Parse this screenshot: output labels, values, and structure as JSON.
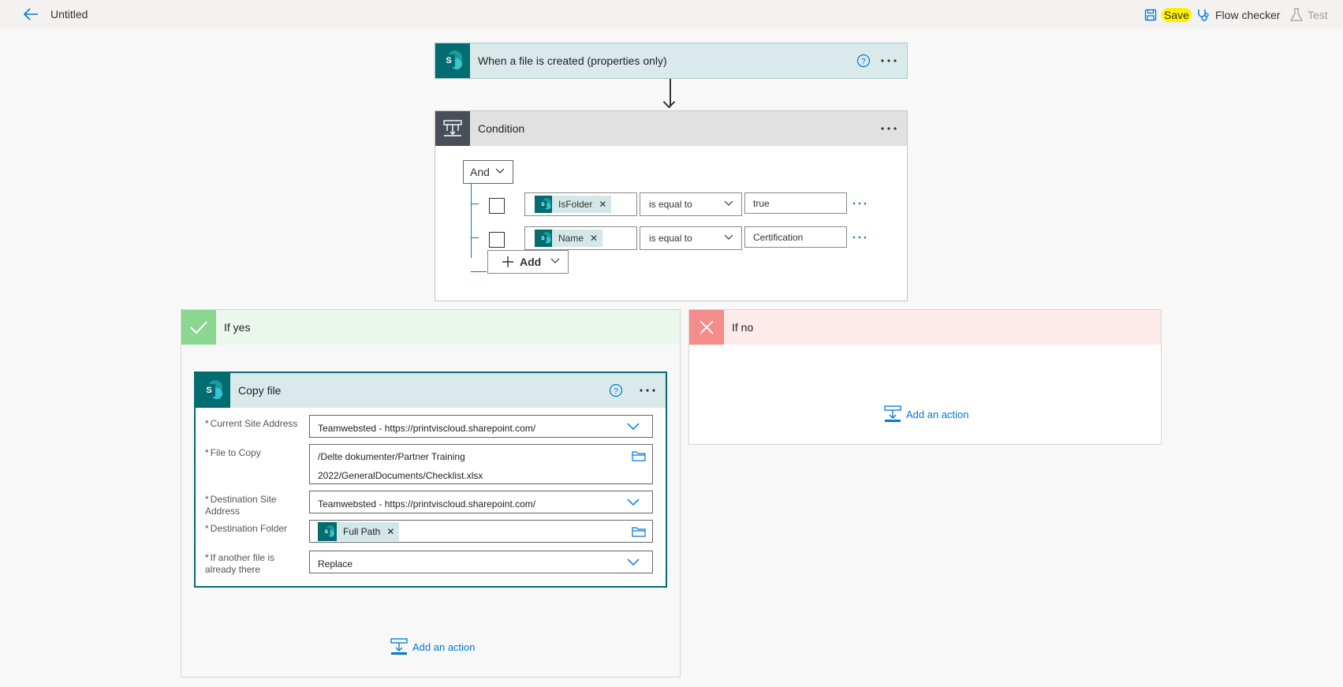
{
  "topbar": {
    "title": "Untitled",
    "save_label": "Save",
    "checker_label": "Flow checker",
    "test_label": "Test"
  },
  "trigger": {
    "title": "When a file is created (properties only)"
  },
  "condition": {
    "title": "Condition",
    "group_operator": "And",
    "rows": [
      {
        "field": "IsFolder",
        "operator": "is equal to",
        "value": "true"
      },
      {
        "field": "Name",
        "operator": "is equal to",
        "value": "Certification"
      }
    ],
    "add_label": "Add"
  },
  "branches": {
    "yes_title": "If yes",
    "no_title": "If no",
    "add_action_label": "Add an action"
  },
  "copy_file": {
    "title": "Copy file",
    "fields": {
      "current_site_label": "Current Site Address",
      "current_site_value": "Teamwebsted - https://printviscloud.sharepoint.com/",
      "file_to_copy_label": "File to Copy",
      "file_to_copy_line1": "/Delte dokumenter/Partner Training",
      "file_to_copy_line2": "2022/GeneralDocuments/Checklist.xlsx",
      "dest_site_label": "Destination Site Address",
      "dest_site_value": "Teamwebsted - https://printviscloud.sharepoint.com/",
      "dest_folder_label": "Destination Folder",
      "dest_folder_token": "Full Path",
      "conflict_label": "If another file is already there",
      "conflict_value": "Replace"
    }
  },
  "colors": {
    "sharepoint_teal": "#036c70",
    "trigger_header_bg": "#daeaeb",
    "condition_header_bg": "#e1e1e1",
    "condition_icon_bg": "#484f58",
    "yes_header_bg": "#ebf6ec",
    "yes_icon_bg": "#8cd790",
    "no_header_bg": "#fdeaea",
    "no_icon_bg": "#f48c8c",
    "link_blue": "#0078d4",
    "save_highlight": "#fff200"
  }
}
